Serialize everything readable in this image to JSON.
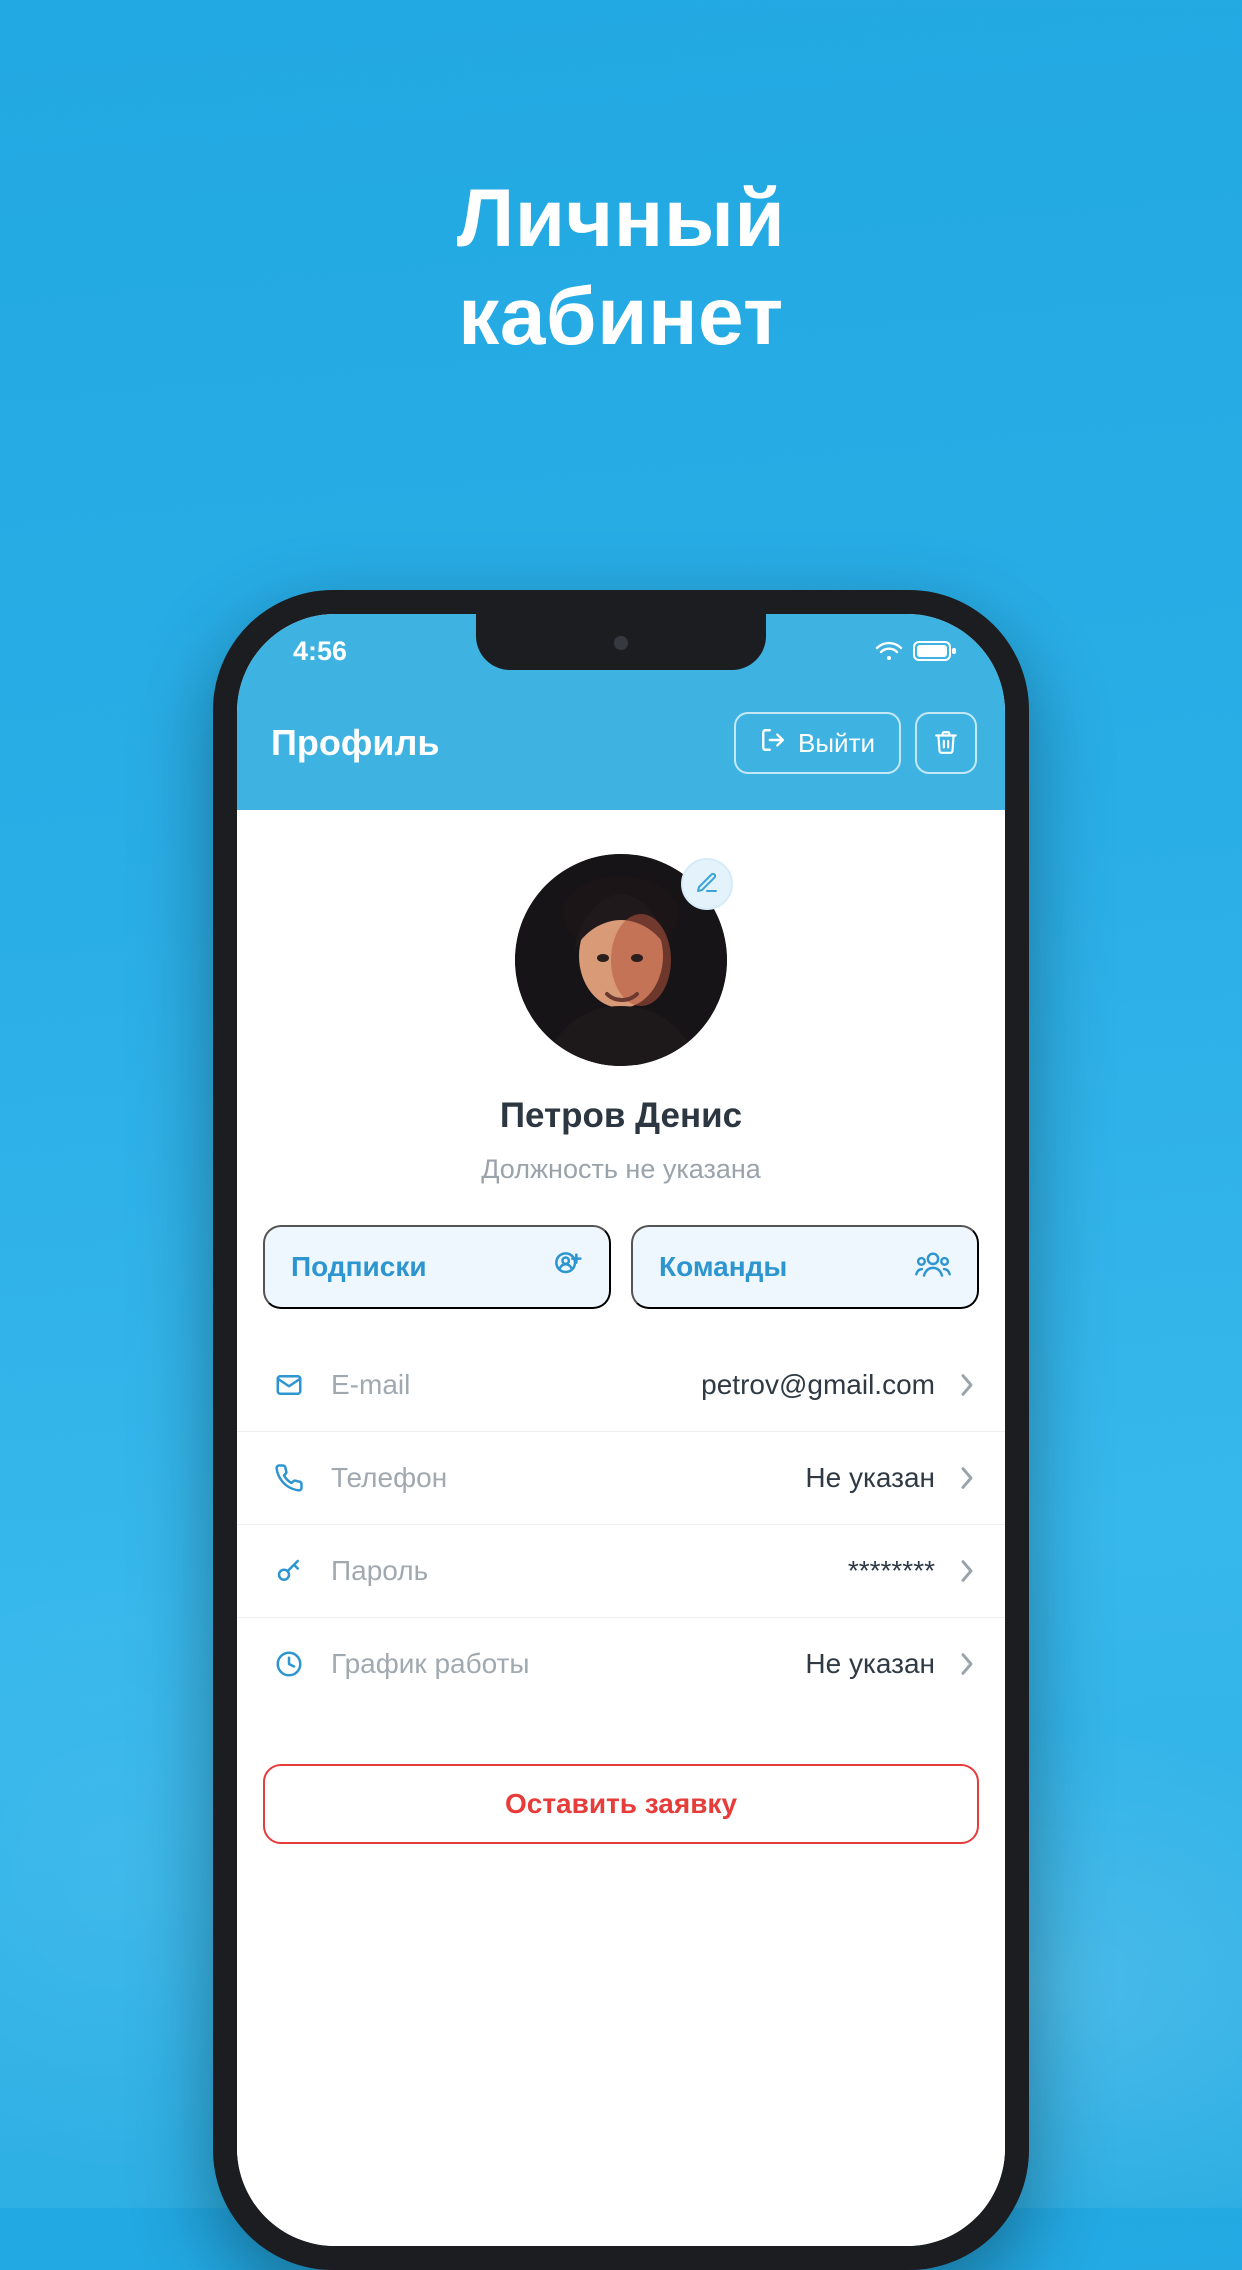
{
  "promo": {
    "line1": "Личный",
    "line2": "кабинет"
  },
  "statusbar": {
    "time": "4:56"
  },
  "topbar": {
    "title": "Профиль",
    "logout_label": "Выйти"
  },
  "user": {
    "name": "Петров Денис",
    "subtitle": "Должность не указана"
  },
  "chips": {
    "subscriptions_label": "Подписки",
    "teams_label": "Команды"
  },
  "rows": {
    "email": {
      "label": "E-mail",
      "value": "petrov@gmail.com"
    },
    "phone": {
      "label": "Телефон",
      "value": "Не указан"
    },
    "password": {
      "label": "Пароль",
      "value": "********"
    },
    "schedule": {
      "label": "График работы",
      "value": "Не указан"
    }
  },
  "cta": {
    "label": "Оставить заявку"
  }
}
